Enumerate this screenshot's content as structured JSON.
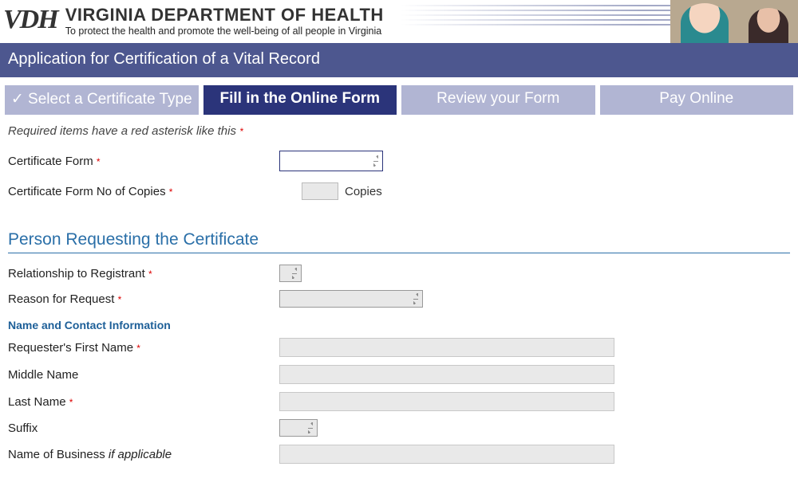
{
  "header": {
    "logo_text": "VDH",
    "department": "VIRGINIA DEPARTMENT OF HEALTH",
    "tagline": "To protect the health and promote the well-being of all people in Virginia"
  },
  "titlebar": "Application for Certification of a Vital Record",
  "steps": [
    {
      "label": "Select a Certificate Type",
      "state": "done"
    },
    {
      "label": "Fill in the Online Form",
      "state": "active"
    },
    {
      "label": "Review your Form",
      "state": "pending"
    },
    {
      "label": "Pay Online",
      "state": "pending"
    }
  ],
  "hint_prefix": "Required items have a red asterisk like this ",
  "fields": {
    "certificate_form": {
      "label": "Certificate Form",
      "required": true,
      "value": ""
    },
    "copies": {
      "label": "Certificate Form No of Copies",
      "required": true,
      "value": "",
      "unit": "Copies"
    }
  },
  "section_requester": {
    "heading": "Person Requesting the Certificate",
    "relationship": {
      "label": "Relationship to Registrant",
      "required": true,
      "value": ""
    },
    "reason": {
      "label": "Reason for Request",
      "required": true,
      "value": ""
    },
    "subheading": "Name and Contact Information",
    "first_name": {
      "label": "Requester's First Name",
      "required": true,
      "value": ""
    },
    "middle_name": {
      "label": "Middle Name",
      "required": false,
      "value": ""
    },
    "last_name": {
      "label": "Last Name",
      "required": true,
      "value": ""
    },
    "suffix": {
      "label": "Suffix",
      "required": false,
      "value": ""
    },
    "business": {
      "label_main": "Name of Business ",
      "label_ital": "if applicable",
      "required": false,
      "value": ""
    }
  }
}
